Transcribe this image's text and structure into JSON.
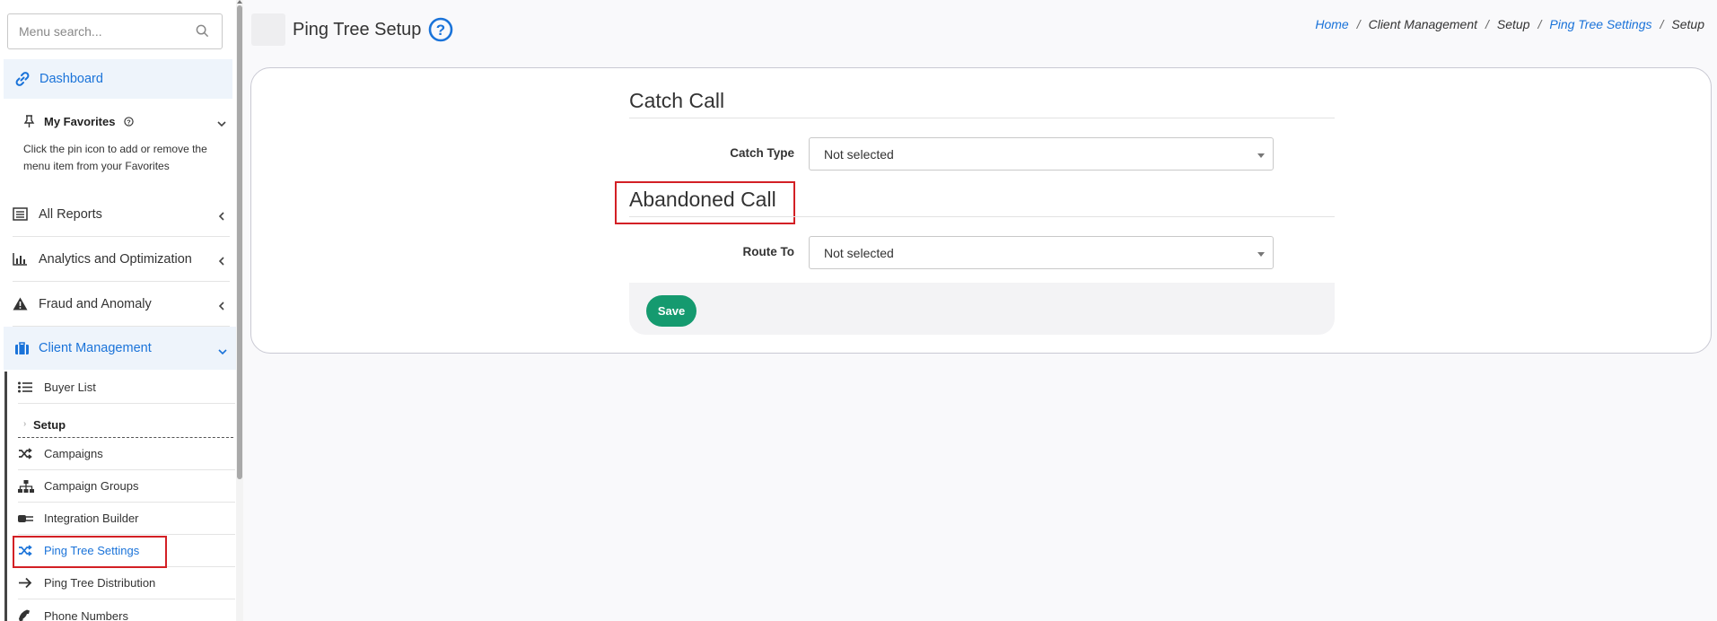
{
  "sidebar": {
    "search": {
      "placeholder": "Menu search..."
    },
    "dashboard": "Dashboard",
    "favorites": {
      "title": "My Favorites",
      "description": "Click the pin icon to add or remove the menu item from your Favorites"
    },
    "items": [
      {
        "label": "All Reports"
      },
      {
        "label": "Analytics and Optimization"
      },
      {
        "label": "Fraud and Anomaly"
      }
    ],
    "client_management": "Client Management",
    "sub_items": {
      "buyer_list": "Buyer List",
      "setup": "Setup",
      "campaigns": "Campaigns",
      "campaign_groups": "Campaign Groups",
      "integration_builder": "Integration Builder",
      "ping_tree_settings": "Ping Tree Settings",
      "ping_tree_distribution": "Ping Tree Distribution",
      "phone_numbers": "Phone Numbers"
    }
  },
  "header": {
    "title": "Ping Tree Setup",
    "breadcrumb": [
      "Home",
      "Client Management",
      "Setup",
      "Ping Tree Settings",
      "Setup"
    ]
  },
  "form": {
    "catch_call": {
      "title": "Catch Call",
      "catch_type_label": "Catch Type",
      "catch_type_value": "Not selected"
    },
    "abandoned_call": {
      "title": "Abandoned Call",
      "route_to_label": "Route To",
      "route_to_value": "Not selected"
    },
    "save_label": "Save"
  },
  "colors": {
    "accent": "#1a73d9",
    "save": "#159a6f",
    "highlight": "#d32025"
  }
}
